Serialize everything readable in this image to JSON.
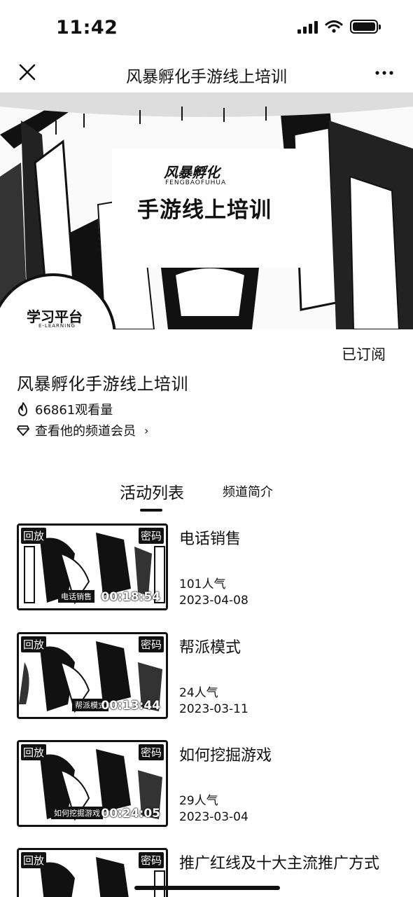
{
  "status_bar": {
    "time": "11:42"
  },
  "nav": {
    "title": "风暴孵化手游线上培训",
    "close_icon": "close-icon",
    "more_icon": "more-icon"
  },
  "banner": {
    "logo_text": "风暴孵化",
    "logo_sub": "FENGBAOFUHUA",
    "heading": "手游线上培训",
    "badge_title": "学习平台",
    "badge_sub": "E-LEARNING"
  },
  "channel": {
    "subscribe_status": "已订阅",
    "title": "风暴孵化手游线上培训",
    "views": "66861观看量",
    "member_link": "查看他的频道会员",
    "views_icon": "flame-icon",
    "member_icon": "diamond-icon"
  },
  "tabs": [
    {
      "label": "活动列表",
      "active": true
    },
    {
      "label": "频道简介",
      "active": false
    }
  ],
  "activities": [
    {
      "title": "电话销售",
      "popularity": "101人气",
      "date": "2023-04-08",
      "duration": "00:18:54",
      "caption": "电话销售",
      "tag_left": "回放",
      "tag_right": "密码"
    },
    {
      "title": "帮派模式",
      "popularity": "24人气",
      "date": "2023-03-11",
      "duration": "00:13:44",
      "caption": "帮派模式",
      "tag_left": "回放",
      "tag_right": "密码"
    },
    {
      "title": "如何挖掘游戏",
      "popularity": "29人气",
      "date": "2023-03-04",
      "duration": "00:24:05",
      "caption": "如何挖掘游戏",
      "tag_left": "回放",
      "tag_right": "密码"
    },
    {
      "title": "推广红线及十大主流推广方式",
      "popularity": "",
      "date": "",
      "duration": "",
      "caption": "",
      "tag_left": "回放",
      "tag_right": "密码"
    }
  ]
}
